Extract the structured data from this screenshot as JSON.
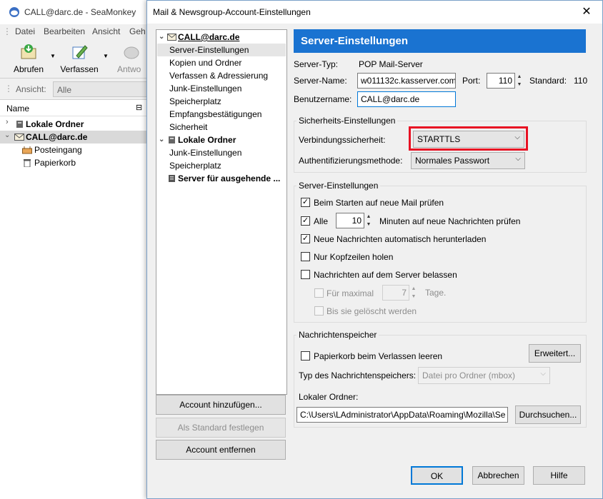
{
  "main_window": {
    "title": "CALL@darc.de - SeaMonkey",
    "menu": [
      "Datei",
      "Bearbeiten",
      "Ansicht",
      "Geh"
    ],
    "toolbar": {
      "get": "Abrufen",
      "compose": "Verfassen",
      "reply": "Antwo"
    },
    "view_label": "Ansicht:",
    "view_value": "Alle",
    "column_name": "Name",
    "folders": [
      {
        "label": "Lokale Ordner",
        "bold": true
      },
      {
        "label": "CALL@darc.de",
        "bold": true
      },
      {
        "label": "Posteingang"
      },
      {
        "label": "Papierkorb"
      }
    ]
  },
  "dialog": {
    "title": "Mail & Newsgroup-Account-Einstellungen",
    "close_glyph": "✕",
    "tree": [
      {
        "label": "CALL@darc.de",
        "bold": true,
        "account": true
      },
      {
        "label": "Server-Einstellungen",
        "selected": true
      },
      {
        "label": "Kopien und Ordner"
      },
      {
        "label": "Verfassen & Adressierung"
      },
      {
        "label": "Junk-Einstellungen"
      },
      {
        "label": "Speicherplatz"
      },
      {
        "label": "Empfangsbestätigungen"
      },
      {
        "label": "Sicherheit"
      },
      {
        "label": "Lokale Ordner",
        "bold": true,
        "account": true
      },
      {
        "label": "Junk-Einstellungen"
      },
      {
        "label": "Speicherplatz"
      },
      {
        "label": "Server für ausgehende ...",
        "bold": true
      }
    ],
    "buttons": {
      "add_account": "Account hinzufügen...",
      "set_default": "Als Standard festlegen",
      "remove_account": "Account entfernen",
      "ok": "OK",
      "cancel": "Abbrechen",
      "help": "Hilfe"
    },
    "panel": {
      "heading": "Server-Einstellungen",
      "server_type_label": "Server-Typ:",
      "server_type_value": "POP Mail-Server",
      "server_name_label": "Server-Name:",
      "server_name_value": "w011132c.kasserver.com",
      "port_label": "Port:",
      "port_value": "110",
      "standard_label": "Standard:",
      "standard_value": "110",
      "username_label": "Benutzername:",
      "username_value": "CALL@darc.de",
      "security": {
        "group_title": "Sicherheits-Einstellungen",
        "connection_label": "Verbindungssicherheit:",
        "connection_value": "STARTTLS",
        "auth_label": "Authentifizierungsmethode:",
        "auth_value": "Normales Passwort",
        "highlight_color": "#e81123"
      },
      "server_settings": {
        "group_title": "Server-Einstellungen",
        "check_on_start": "Beim Starten auf neue Mail prüfen",
        "check_every_label": "Alle",
        "check_every_value": "10",
        "check_every_suffix": "Minuten auf neue Nachrichten prüfen",
        "auto_download": "Neue Nachrichten automatisch herunterladen",
        "headers_only": "Nur Kopfzeilen holen",
        "leave_on_server": "Nachrichten auf dem Server belassen",
        "max_days_label": "Für maximal",
        "max_days_value": "7",
        "max_days_suffix": "Tage.",
        "until_deleted": "Bis sie gelöscht werden"
      },
      "storage": {
        "group_title": "Nachrichtenspeicher",
        "empty_trash": "Papierkorb beim Verlassen leeren",
        "advanced_button": "Erweitert...",
        "store_type_label": "Typ des Nachrichtenspeichers:",
        "store_type_value": "Datei pro Ordner (mbox)",
        "local_dir_label": "Lokaler Ordner:",
        "local_dir_value": "C:\\Users\\LAdministrator\\AppData\\Roaming\\Mozilla\\Se",
        "browse_button": "Durchsuchen..."
      }
    }
  }
}
